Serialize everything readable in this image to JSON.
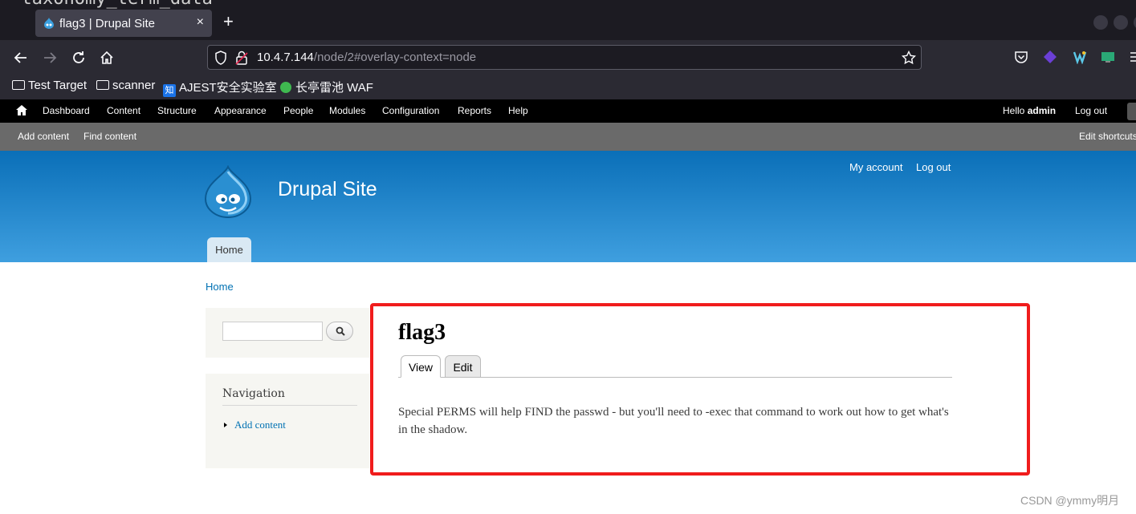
{
  "browser": {
    "behind_text": "  taxonomy_term_data",
    "tab_title": "flag3 | Drupal Site",
    "tab_close": "×",
    "new_tab": "+",
    "url_host": "10.4.7.144",
    "url_path": "/node/2#overlay-context=node",
    "bookmarks": [
      "Test Target",
      "scanner",
      "AJEST安全实验室",
      "长亭雷池 WAF"
    ],
    "bookmark_badge": "知"
  },
  "toolbar": {
    "items": [
      "Dashboard",
      "Content",
      "Structure",
      "Appearance",
      "People",
      "Modules",
      "Configuration",
      "Reports",
      "Help"
    ],
    "hello": "Hello ",
    "user": "admin",
    "logout": "Log out"
  },
  "shortcuts": {
    "add_content": "Add content",
    "find_content": "Find content",
    "edit_shortcuts": "Edit shortcuts"
  },
  "header": {
    "site_name": "Drupal Site",
    "my_account": "My account",
    "log_out": "Log out",
    "home_tab": "Home"
  },
  "main": {
    "breadcrumb": "Home",
    "nav_title": "Navigation",
    "nav_link": "Add content",
    "node_title": "flag3",
    "tab_view": "View",
    "tab_edit": "Edit",
    "body": "Special PERMS will help FIND the passwd - but you'll need to -exec that command to work out how to get what's in the shadow."
  },
  "watermark": "CSDN @ymmy明月",
  "colors": {
    "highlight": "#f01c1c",
    "header_top": "#0a6fb8",
    "header_bottom": "#3f9fdf",
    "link": "#0071b3"
  }
}
